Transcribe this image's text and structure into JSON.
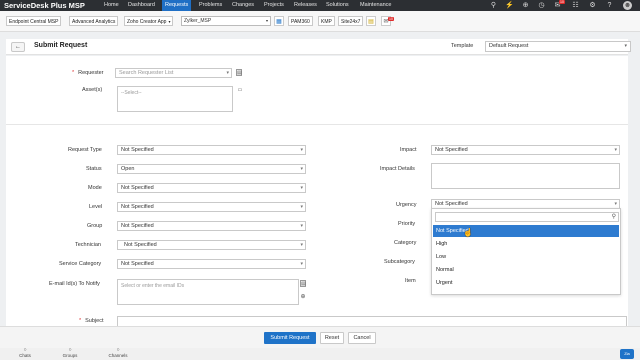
{
  "nav": {
    "brand": "ServiceDesk Plus MSP",
    "items": [
      "Home",
      "Dashboard",
      "Requests",
      "Problems",
      "Changes",
      "Projects",
      "Releases",
      "Solutions",
      "Maintenance"
    ],
    "active": "Requests",
    "notification_count": "10"
  },
  "toolbar": {
    "endpoint": "Endpoint Central MSP",
    "analytics": "Advanced Analytics",
    "creator": "Zoho Creator App",
    "account": "Zylker_MSP",
    "pam": "PAM360",
    "kmp": "KMP",
    "site": "Site24x7"
  },
  "header": {
    "title": "Submit Request",
    "template_label": "Template",
    "template_value": "Default Request"
  },
  "form": {
    "requester_label": "Requester",
    "requester_placeholder": "Search Requester List",
    "assets_label": "Asset(s)",
    "assets_placeholder": "--Select--",
    "request_type_label": "Request Type",
    "request_type": "Not Specified",
    "status_label": "Status",
    "status": "Open",
    "mode_label": "Mode",
    "mode": "Not Specified",
    "level_label": "Level",
    "level": "Not Specified",
    "group_label": "Group",
    "group": "Not Specified",
    "technician_label": "Technician",
    "technician": "Not Specified",
    "service_category_label": "Service Category",
    "service_category": "Not Specified",
    "email_label": "E-mail Id(s) To Notify",
    "email_placeholder": "Select or enter the email IDs",
    "subject_label": "Subject",
    "impact_label": "Impact",
    "impact": "Not Specified",
    "impact_details_label": "Impact Details",
    "urgency_label": "Urgency",
    "urgency": "Not Specified",
    "priority_label": "Priority",
    "category_label": "Category",
    "subcategory_label": "Subcategory",
    "item_label": "Item"
  },
  "urgency_dropdown": {
    "options": [
      "Not Specified",
      "High",
      "Low",
      "Normal",
      "Urgent"
    ],
    "highlighted": "Not Specified"
  },
  "footer": {
    "submit": "Submit Request",
    "reset": "Reset",
    "cancel": "Cancel"
  },
  "bottombar": {
    "chats": "Chats",
    "groups": "Groups",
    "channels": "Channels",
    "zia": "Zia"
  },
  "colors": {
    "accent": "#1f73c8",
    "nav_bg": "#2c2f33",
    "highlight": "#2e7bd0",
    "badge": "#e02b2b"
  }
}
